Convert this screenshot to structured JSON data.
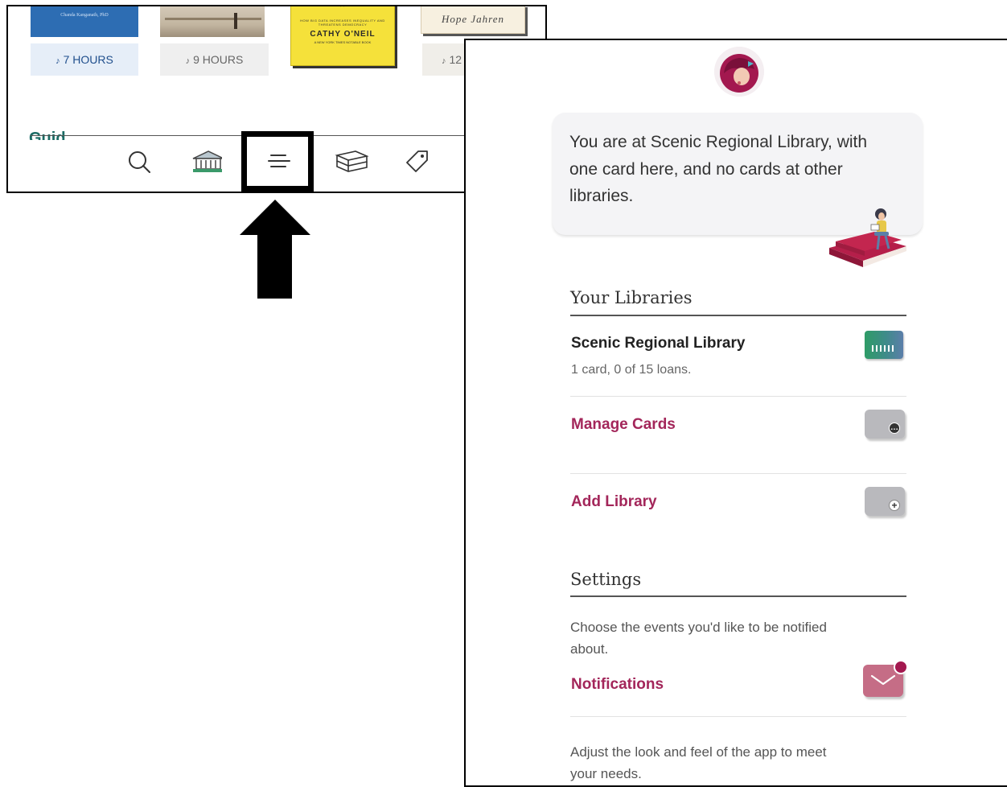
{
  "left_screen": {
    "books": [
      {
        "author_text": "Chanda Kanganath, PhD"
      },
      {
        "author_text": ""
      },
      {
        "author_text": "CATHY O'NEIL",
        "tag_text": "HOW BIG DATA INCREASES INEQUALITY AND THREATENS DEMOCRACY",
        "sub_text": "A NEW YORK TIMES NOTABLE BOOK"
      },
      {
        "author_text": "Hope Jahren"
      }
    ],
    "durations": [
      "7 HOURS",
      "9 HOURS",
      "12"
    ],
    "nav_icons": [
      "search-icon",
      "library-icon",
      "menu-icon",
      "shelf-icon",
      "tag-icon"
    ]
  },
  "right_screen": {
    "location_message": "You are at Scenic Regional Library, with one card here, and no cards at other libraries.",
    "your_libraries": {
      "title": "Your Libraries",
      "library": {
        "name": "Scenic Regional Library",
        "status": "1 card, 0 of 15 loans."
      },
      "manage_cards_label": "Manage Cards",
      "add_library_label": "Add Library"
    },
    "settings": {
      "title": "Settings",
      "notifications_desc": "Choose the events you'd like to be notified about.",
      "notifications_label": "Notifications",
      "appearance_desc": "Adjust the look and feel of the app to meet your needs."
    }
  },
  "colors": {
    "accent": "#a3265a",
    "highlight": "#000000"
  }
}
